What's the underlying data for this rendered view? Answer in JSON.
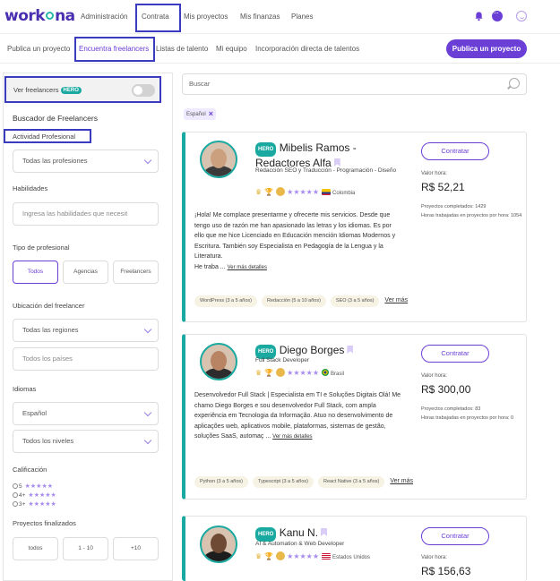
{
  "app": {
    "logo": "workana",
    "nav": [
      {
        "label": "Administración"
      },
      {
        "label": "Contrata"
      },
      {
        "label": "Mis proyectos"
      },
      {
        "label": "Mis finanzas"
      },
      {
        "label": "Planes"
      }
    ],
    "subnav": [
      {
        "label": "Publica un proyecto"
      },
      {
        "label": "Encuentra freelancers"
      },
      {
        "label": "Listas de talento"
      },
      {
        "label": "Mi equipo"
      },
      {
        "label": "Incorporación directa de talentos"
      }
    ],
    "publish_button": "Publica un proyecto"
  },
  "filters": {
    "toggle_label": "Ver freelancers",
    "hero": "HERO",
    "heading": "Buscador de Freelancers",
    "professional_activity_label": "Actividad Profesional",
    "professions_select": "Todas las profesiones",
    "skills_label": "Habilidades",
    "skills_placeholder": "Ingresa las habilidades que necesit",
    "type_label": "Tipo de profesional",
    "type_options": [
      "Todos",
      "Agencias",
      "Freelancers"
    ],
    "location_label": "Ubicación del freelancer",
    "regions_select": "Todas las regiones",
    "countries_input": "Todos los países",
    "languages_label": "Idiomas",
    "language_select": "Español",
    "levels_select": "Todos los niveles",
    "rating_label": "Calificación",
    "ratings": [
      {
        "label": "5",
        "stars": 5
      },
      {
        "label": "4+",
        "stars": 4
      },
      {
        "label": "3+",
        "stars": 3
      }
    ],
    "projects_label": "Proyectos finalizados",
    "projects_options": [
      "todos",
      "1 - 10",
      "+10"
    ]
  },
  "search": {
    "placeholder": "Buscar",
    "chip": "Español"
  },
  "freelancers": [
    {
      "hero": "HERO",
      "name": "Mibelis Ramos - Redactores Alfa",
      "title": "Redacción SEO y Traducción - Programación - Diseño",
      "stars": "★★★★★",
      "country": "Colombia",
      "description": "¡Hola! Me complace presentarme y ofrecerte mis servicios. Desde que tengo uso de razón me han apasionado las letras y los idiomas. Es por ello que me hice Licenciado en Educación mención Idiomas Modernos y Escritura. También soy Especialista en Pedagogía de la Lengua y la Literatura.",
      "description_tail": "He traba ...",
      "see_more": "Ver más detalles",
      "skills": [
        "WordPress (3 a 5 años)",
        "Redacción (5 a 10 años)",
        "SEO (3 a 5 años)"
      ],
      "skills_more": "Ver más",
      "hire_button": "Contratar",
      "rate_label": "Valor hora:",
      "rate": "R$ 52,21",
      "completed": "Proyectos completados: 1429",
      "hours": "Horas trabajadas en proyectos por hora: 1054"
    },
    {
      "hero": "HERO",
      "name": "Diego Borges",
      "title": "Full Stack Developer",
      "stars": "★★★★★",
      "country": "Brasil",
      "description": "Desenvolvedor Full Stack | Especialista em TI e Soluções Digitais Olá! Me chamo Diego Borges e sou desenvolvedor Full Stack, com ampla experiência em Tecnologia da Informação. Atuo no desenvolvimento de aplicações web, aplicativos mobile, plataformas, sistemas de gestão, soluções SaaS, automaç ...",
      "see_more": "Ver más detalles",
      "skills": [
        "Python (3 a 5 años)",
        "Typescript (3 a 5 años)",
        "React Native (3 a 5 años)"
      ],
      "skills_more": "Ver más",
      "hire_button": "Contratar",
      "rate_label": "Valor hora:",
      "rate": "R$ 300,00",
      "completed": "Proyectos completados: 83",
      "hours": "Horas trabajadas en proyectos por hora: 0"
    },
    {
      "hero": "HERO",
      "name": "Kanu N.",
      "title": "AI & Automation & Web Developer",
      "stars": "★★★★★",
      "country": "Estados Unidos",
      "hire_button": "Contratar",
      "rate_label": "Valor hora:",
      "rate": "R$ 156,63"
    }
  ],
  "colors": {
    "brand": "#6b3fd6",
    "teal": "#1aa9a0",
    "highlight": "#3b3bbf"
  }
}
